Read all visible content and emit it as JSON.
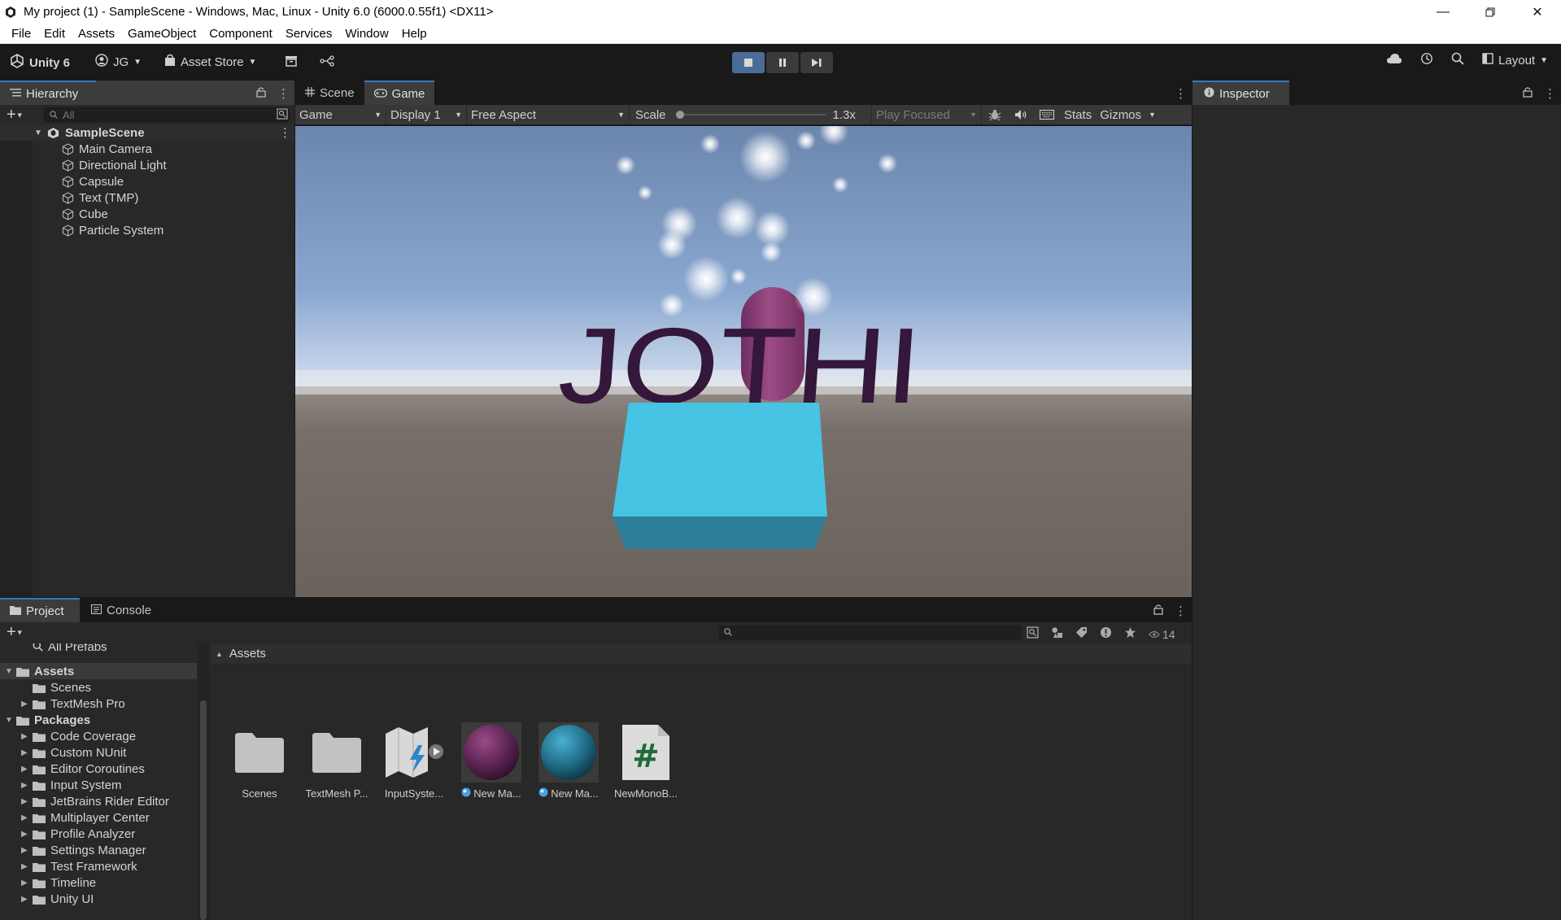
{
  "window": {
    "title": "My project (1) - SampleScene - Windows, Mac, Linux - Unity 6.0 (6000.0.55f1) <DX11>"
  },
  "menu": [
    "File",
    "Edit",
    "Assets",
    "GameObject",
    "Component",
    "Services",
    "Window",
    "Help"
  ],
  "toolbar": {
    "unity_label": "Unity 6",
    "account_label": "JG",
    "asset_store_label": "Asset Store",
    "layout_label": "Layout"
  },
  "hierarchy": {
    "tab_label": "Hierarchy",
    "search_placeholder": "All",
    "scene_name": "SampleScene",
    "objects": [
      "Main Camera",
      "Directional Light",
      "Capsule",
      "Text (TMP)",
      "Cube",
      "Particle System"
    ]
  },
  "center_tabs": {
    "scene": "Scene",
    "game": "Game"
  },
  "game_toolbar": {
    "mode": "Game",
    "display": "Display 1",
    "aspect": "Free Aspect",
    "scale_label": "Scale",
    "scale_value": "1.3x",
    "play_focus": "Play Focused",
    "stats": "Stats",
    "gizmos": "Gizmos"
  },
  "game_scene": {
    "text": "JOTHI",
    "colors": {
      "sky_top": "#6f8bb1",
      "sky_horizon": "#f0f4fa",
      "ground": "#6b635f",
      "text": "#34173a",
      "capsule": "#8e3f78",
      "cube_front": "#48c4e5",
      "cube_bottom": "#2f7e99"
    }
  },
  "inspector": {
    "tab_label": "Inspector"
  },
  "bottom_tabs": {
    "project": "Project",
    "console": "Console"
  },
  "project": {
    "asset_count": "14",
    "favorites_item": "All Prefabs",
    "tree": [
      {
        "label": "Assets",
        "level": 0,
        "bold": true,
        "expanded": true,
        "selected": true
      },
      {
        "label": "Scenes",
        "level": 1,
        "arrow": false
      },
      {
        "label": "TextMesh Pro",
        "level": 1,
        "arrow": true
      },
      {
        "label": "Packages",
        "level": 0,
        "bold": true,
        "expanded": true
      },
      {
        "label": "Code Coverage",
        "level": 1,
        "arrow": true
      },
      {
        "label": "Custom NUnit",
        "level": 1,
        "arrow": true
      },
      {
        "label": "Editor Coroutines",
        "level": 1,
        "arrow": true
      },
      {
        "label": "Input System",
        "level": 1,
        "arrow": true
      },
      {
        "label": "JetBrains Rider Editor",
        "level": 1,
        "arrow": true
      },
      {
        "label": "Multiplayer Center",
        "level": 1,
        "arrow": true
      },
      {
        "label": "Profile Analyzer",
        "level": 1,
        "arrow": true
      },
      {
        "label": "Settings Manager",
        "level": 1,
        "arrow": true
      },
      {
        "label": "Test Framework",
        "level": 1,
        "arrow": true
      },
      {
        "label": "Timeline",
        "level": 1,
        "arrow": true
      },
      {
        "label": "Unity UI",
        "level": 1,
        "arrow": true
      }
    ],
    "breadcrumb": "Assets",
    "assets": [
      {
        "label": "Scenes",
        "kind": "folder"
      },
      {
        "label": "TextMesh P...",
        "kind": "folder"
      },
      {
        "label": "InputSyste...",
        "kind": "input-actions"
      },
      {
        "label": "New Ma...",
        "kind": "material",
        "color": "#6a2a5c"
      },
      {
        "label": "New Ma...",
        "kind": "material",
        "color": "#2a7a96"
      },
      {
        "label": "NewMonoB...",
        "kind": "script"
      }
    ]
  }
}
